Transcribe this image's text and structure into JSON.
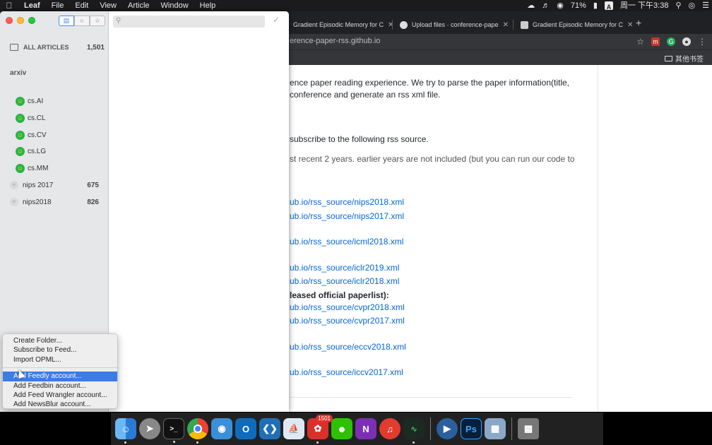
{
  "menubar": {
    "items": [
      "Leaf",
      "File",
      "Edit",
      "View",
      "Article",
      "Window",
      "Help"
    ],
    "battery": "71%",
    "input_badge": "A",
    "clock": "周一 下午3:38"
  },
  "chrome": {
    "tabs": [
      "Gradient Episodic Memory for C",
      "Upload files · conference-pape",
      "Gradient Episodic Memory for C"
    ],
    "url": "erence-paper-rss.github.io",
    "bookmarks_folder": "其他书签"
  },
  "page": {
    "lines": [
      {
        "text": "ence paper reading experience. We try to parse the paper information(title,",
        "style": "normal"
      },
      {
        "text": " conference and generate an rss xml file.",
        "style": "normal"
      },
      {
        "text": " subscribe to the following rss source.",
        "style": "normal"
      },
      {
        "text": "st recent 2 years. earlier years are not included (but you can run our code to",
        "style": "gray"
      },
      {
        "text": "ub.io/rss_source/nips2018.xml",
        "style": "link"
      },
      {
        "text": "ub.io/rss_source/nips2017.xml",
        "style": "link"
      },
      {
        "text": "ub.io/rss_source/icml2018.xml",
        "style": "link"
      },
      {
        "text": "ub.io/rss_source/iclr2019.xml",
        "style": "link"
      },
      {
        "text": "ub.io/rss_source/iclr2018.xml",
        "style": "link"
      },
      {
        "text": "leased official paperlist):",
        "style": "bold"
      },
      {
        "text": "ub.io/rss_source/cvpr2018.xml",
        "style": "link"
      },
      {
        "text": "ub.io/rss_source/cvpr2017.xml",
        "style": "link"
      },
      {
        "text": "ub.io/rss_source/eccv2018.xml",
        "style": "link"
      },
      {
        "text": "ub.io/rss_source/iccv2017.xml",
        "style": "link"
      }
    ]
  },
  "leaf": {
    "all_articles_label": "ALL ARTICLES",
    "all_articles_count": "1,501",
    "section_title": "arxiv",
    "arxiv_feeds": [
      "cs.AI",
      "cs.CL",
      "cs.CV",
      "cs.LG",
      "cs.MM"
    ],
    "other_feeds": [
      {
        "name": "nips 2017",
        "count": "675"
      },
      {
        "name": "nips2018",
        "count": "826"
      }
    ]
  },
  "popup_menu": {
    "group1": [
      "Create Folder...",
      "Subscribe to Feed...",
      "Import OPML..."
    ],
    "group2": [
      "Add Feedly account...",
      "Add Feedbin account...",
      "Add Feed Wrangler account...",
      "Add NewsBlur account..."
    ],
    "selected": "Add Feedly account..."
  },
  "dock": {
    "apps": [
      "finder",
      "launchpad",
      "terminal",
      "chrome",
      "safari-like",
      "outlook",
      "vscode",
      "sailboat",
      "leaf",
      "wechat",
      "onenote",
      "netease-music",
      "activity-monitor",
      "quicktime",
      "photoshop",
      "preview",
      "trash"
    ],
    "leaf_badge": "1501",
    "photoshop_label": "Ps",
    "outlook_label": "O",
    "onenote_label": "N"
  }
}
